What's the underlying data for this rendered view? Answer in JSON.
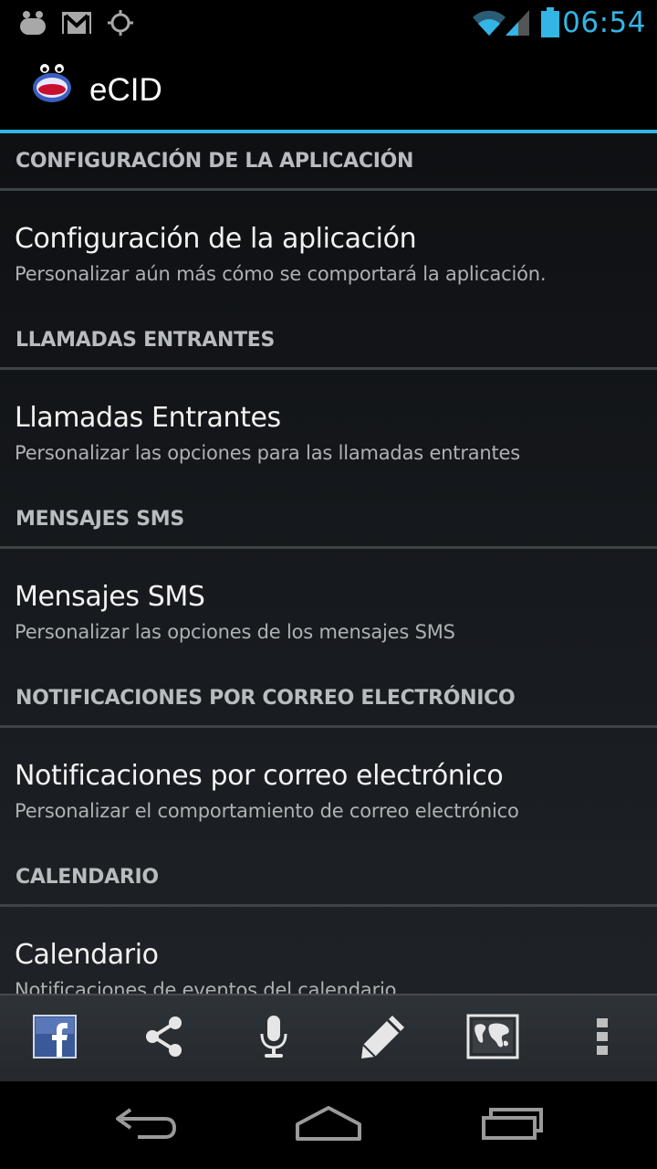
{
  "status_bar": {
    "time": "06:54",
    "icons": [
      "android-notification-icon",
      "gmail-icon",
      "gps-icon",
      "wifi-icon",
      "signal-icon",
      "battery-icon"
    ],
    "accent_color": "#33b5e5"
  },
  "action_bar": {
    "title": "eCID",
    "app_icon": "ecid-app-icon"
  },
  "sections": [
    {
      "header": "CONFIGURACIÓN DE LA APLICACIÓN",
      "title": "Configuración de la aplicación",
      "summary": "Personalizar aún más cómo se comportará la aplicación."
    },
    {
      "header": "LLAMADAS ENTRANTES",
      "title": "Llamadas Entrantes",
      "summary": "Personalizar las opciones para las llamadas entrantes"
    },
    {
      "header": "MENSAJES SMS",
      "title": "Mensajes SMS",
      "summary": "Personalizar las opciones de los mensajes SMS"
    },
    {
      "header": "NOTIFICACIONES POR CORREO ELECTRÓNICO",
      "title": "Notificaciones por correo electrónico",
      "summary": "Personalizar el comportamiento de correo electrónico"
    },
    {
      "header": "CALENDARIO",
      "title": "Calendario",
      "summary": "Notificaciones de eventos del calendario"
    }
  ],
  "toolbar": {
    "buttons": [
      "facebook-icon",
      "share-icon",
      "microphone-icon",
      "pencil-icon",
      "world-map-icon",
      "overflow-menu-icon"
    ]
  },
  "nav_bar": {
    "buttons": [
      "back-icon",
      "home-icon",
      "recent-apps-icon"
    ]
  }
}
